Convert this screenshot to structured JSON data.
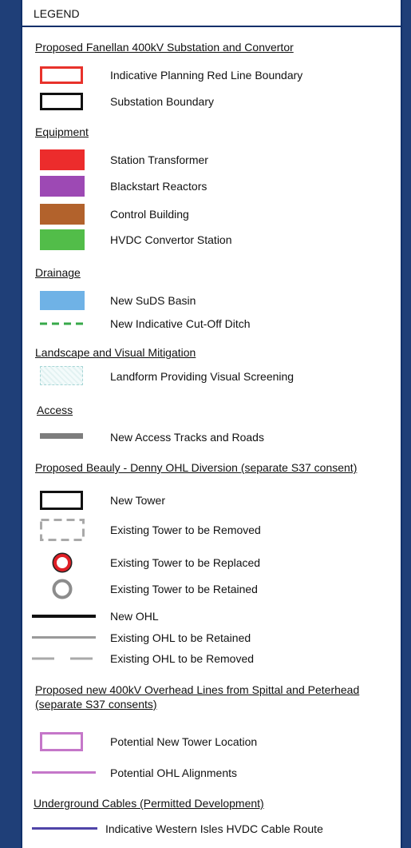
{
  "legend": {
    "title": "LEGEND",
    "sections": {
      "substation": {
        "heading": "Proposed Fanellan 400kV Substation and Convertor",
        "items": [
          "Indicative Planning Red Line Boundary",
          "Substation Boundary"
        ]
      },
      "equipment": {
        "heading": "Equipment",
        "items": [
          "Station Transformer",
          "Blackstart Reactors",
          "Control Building",
          "HVDC Convertor Station"
        ]
      },
      "drainage": {
        "heading": "Drainage",
        "items": [
          "New SuDS Basin",
          "New Indicative Cut-Off Ditch"
        ]
      },
      "landscape": {
        "heading": "Landscape and Visual Mitigation",
        "items": [
          "Landform Providing Visual Screening"
        ]
      },
      "access": {
        "heading": "Access",
        "items": [
          "New Access Tracks and Roads"
        ]
      },
      "ohl_diversion": {
        "heading": "Proposed Beauly - Denny OHL Diversion (separate S37 consent)",
        "items": [
          "New Tower",
          "Existing Tower to be Removed",
          "Existing Tower to be Replaced",
          "Existing Tower to be Retained",
          "New OHL",
          "Existing OHL to be Retained",
          "Existing OHL to be Removed"
        ]
      },
      "new_400kv": {
        "heading_line1": "Proposed new 400kV Overhead Lines from Spittal and Peterhead",
        "heading_line2": "(separate S37 consents)",
        "items": [
          "Potential New Tower Location",
          "Potential OHL Alignments"
        ]
      },
      "underground": {
        "heading": "Underground Cables (Permitted Development)",
        "items": [
          "Indicative Western Isles HVDC Cable Route"
        ]
      }
    }
  },
  "colors": {
    "red_line": "#e8322b",
    "station_transformer": "#ec2c2c",
    "blackstart_reactors": "#9d49b4",
    "control_building": "#b2622c",
    "hvdc_convertor": "#52bd49",
    "suds_basin": "#6fb2e6",
    "cutoff_ditch": "#37a94a",
    "access_track": "#7d7d7d",
    "potential_tower": "#c577c9",
    "cable_route": "#4f44a8"
  }
}
